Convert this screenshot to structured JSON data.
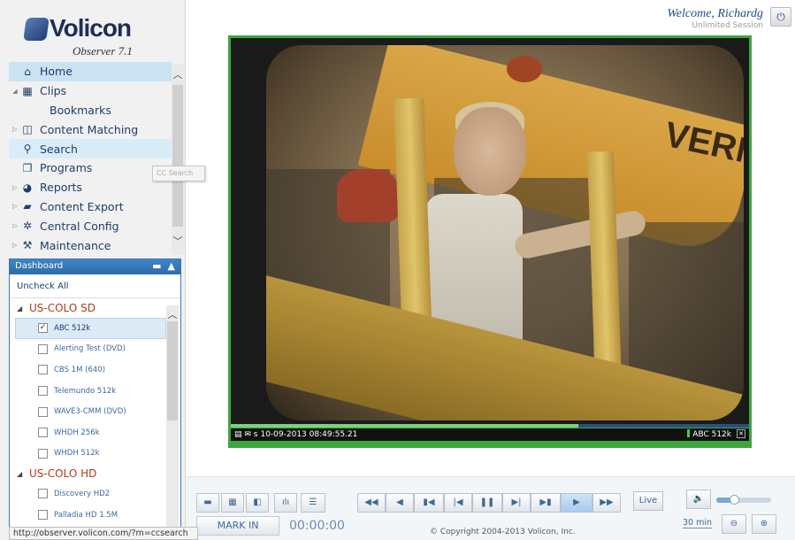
{
  "app": {
    "brand": "Volicon",
    "version": "Observer 7.1"
  },
  "header": {
    "welcome": "Welcome, Richardg",
    "session": "Unlimited Session"
  },
  "nav": {
    "items": [
      {
        "label": "Home",
        "icon": "home-icon"
      },
      {
        "label": "Clips",
        "icon": "film-icon"
      },
      {
        "label": "Bookmarks"
      },
      {
        "label": "Content Matching",
        "icon": "content-matching-icon"
      },
      {
        "label": "Search",
        "icon": "search-icon"
      },
      {
        "label": "Programs",
        "icon": "programs-icon"
      },
      {
        "label": "Reports",
        "icon": "pie-chart-icon"
      },
      {
        "label": "Content Export",
        "icon": "export-icon"
      },
      {
        "label": "Central Config",
        "icon": "gear-icon"
      },
      {
        "label": "Maintenance",
        "icon": "tools-icon"
      }
    ],
    "tooltip": "CC Search"
  },
  "dashboard": {
    "title": "Dashboard",
    "uncheck_all": "Uncheck All",
    "groups": [
      {
        "name": "US-COLO SD",
        "channels": [
          {
            "name": "ABC 512k",
            "checked": true
          },
          {
            "name": "Alerting Test (DVD)",
            "checked": false
          },
          {
            "name": "CBS 1M (640)",
            "checked": false
          },
          {
            "name": "Telemundo 512k",
            "checked": false
          },
          {
            "name": "WAVE3-CMM (DVD)",
            "checked": false
          },
          {
            "name": "WHDH 256k",
            "checked": false
          },
          {
            "name": "WHDH 512k",
            "checked": false
          }
        ]
      },
      {
        "name": "US-COLO HD",
        "channels": [
          {
            "name": "Discovery HD2",
            "checked": false
          },
          {
            "name": "Palladia HD 1.5M",
            "checked": false
          }
        ]
      }
    ]
  },
  "player": {
    "timestamp": "10-09-2013 08:49:55.21",
    "channel": "ABC 512k",
    "bus_text": "VERN",
    "progress": 0.67
  },
  "controls": {
    "mark_in": "MARK IN",
    "timecode": "00:00:00",
    "live": "Live",
    "zoom": "30 min",
    "copyright": "© Copyright 2004-2013 Volicon, Inc.",
    "volume": 0.3
  },
  "status_url": "http://observer.volicon.com/?m=ccsearch",
  "colors": {
    "accent": "#3fa53f",
    "nav_text": "#1d3d6b",
    "group_text": "#b23a1b"
  }
}
